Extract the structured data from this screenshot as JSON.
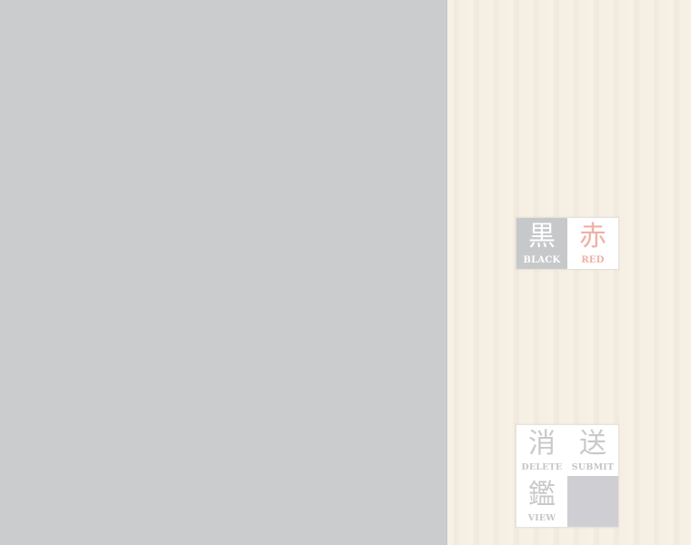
{
  "colors_palette": {
    "black": {
      "glyph": "黒",
      "label": "BLACK"
    },
    "red": {
      "glyph": "赤",
      "label": "RED"
    }
  },
  "actions_palette": {
    "delete": {
      "glyph": "消",
      "label": "DELETE"
    },
    "submit": {
      "glyph": "送",
      "label": "SUBMIT"
    },
    "view": {
      "glyph": "鑑",
      "label": "VIEW"
    }
  },
  "theme": {
    "canvas_bg": "#cbcccd",
    "panel_bg": "#f6eee2",
    "red_accent": "#eeb1a6",
    "black_tile": "#c7c8ca"
  }
}
